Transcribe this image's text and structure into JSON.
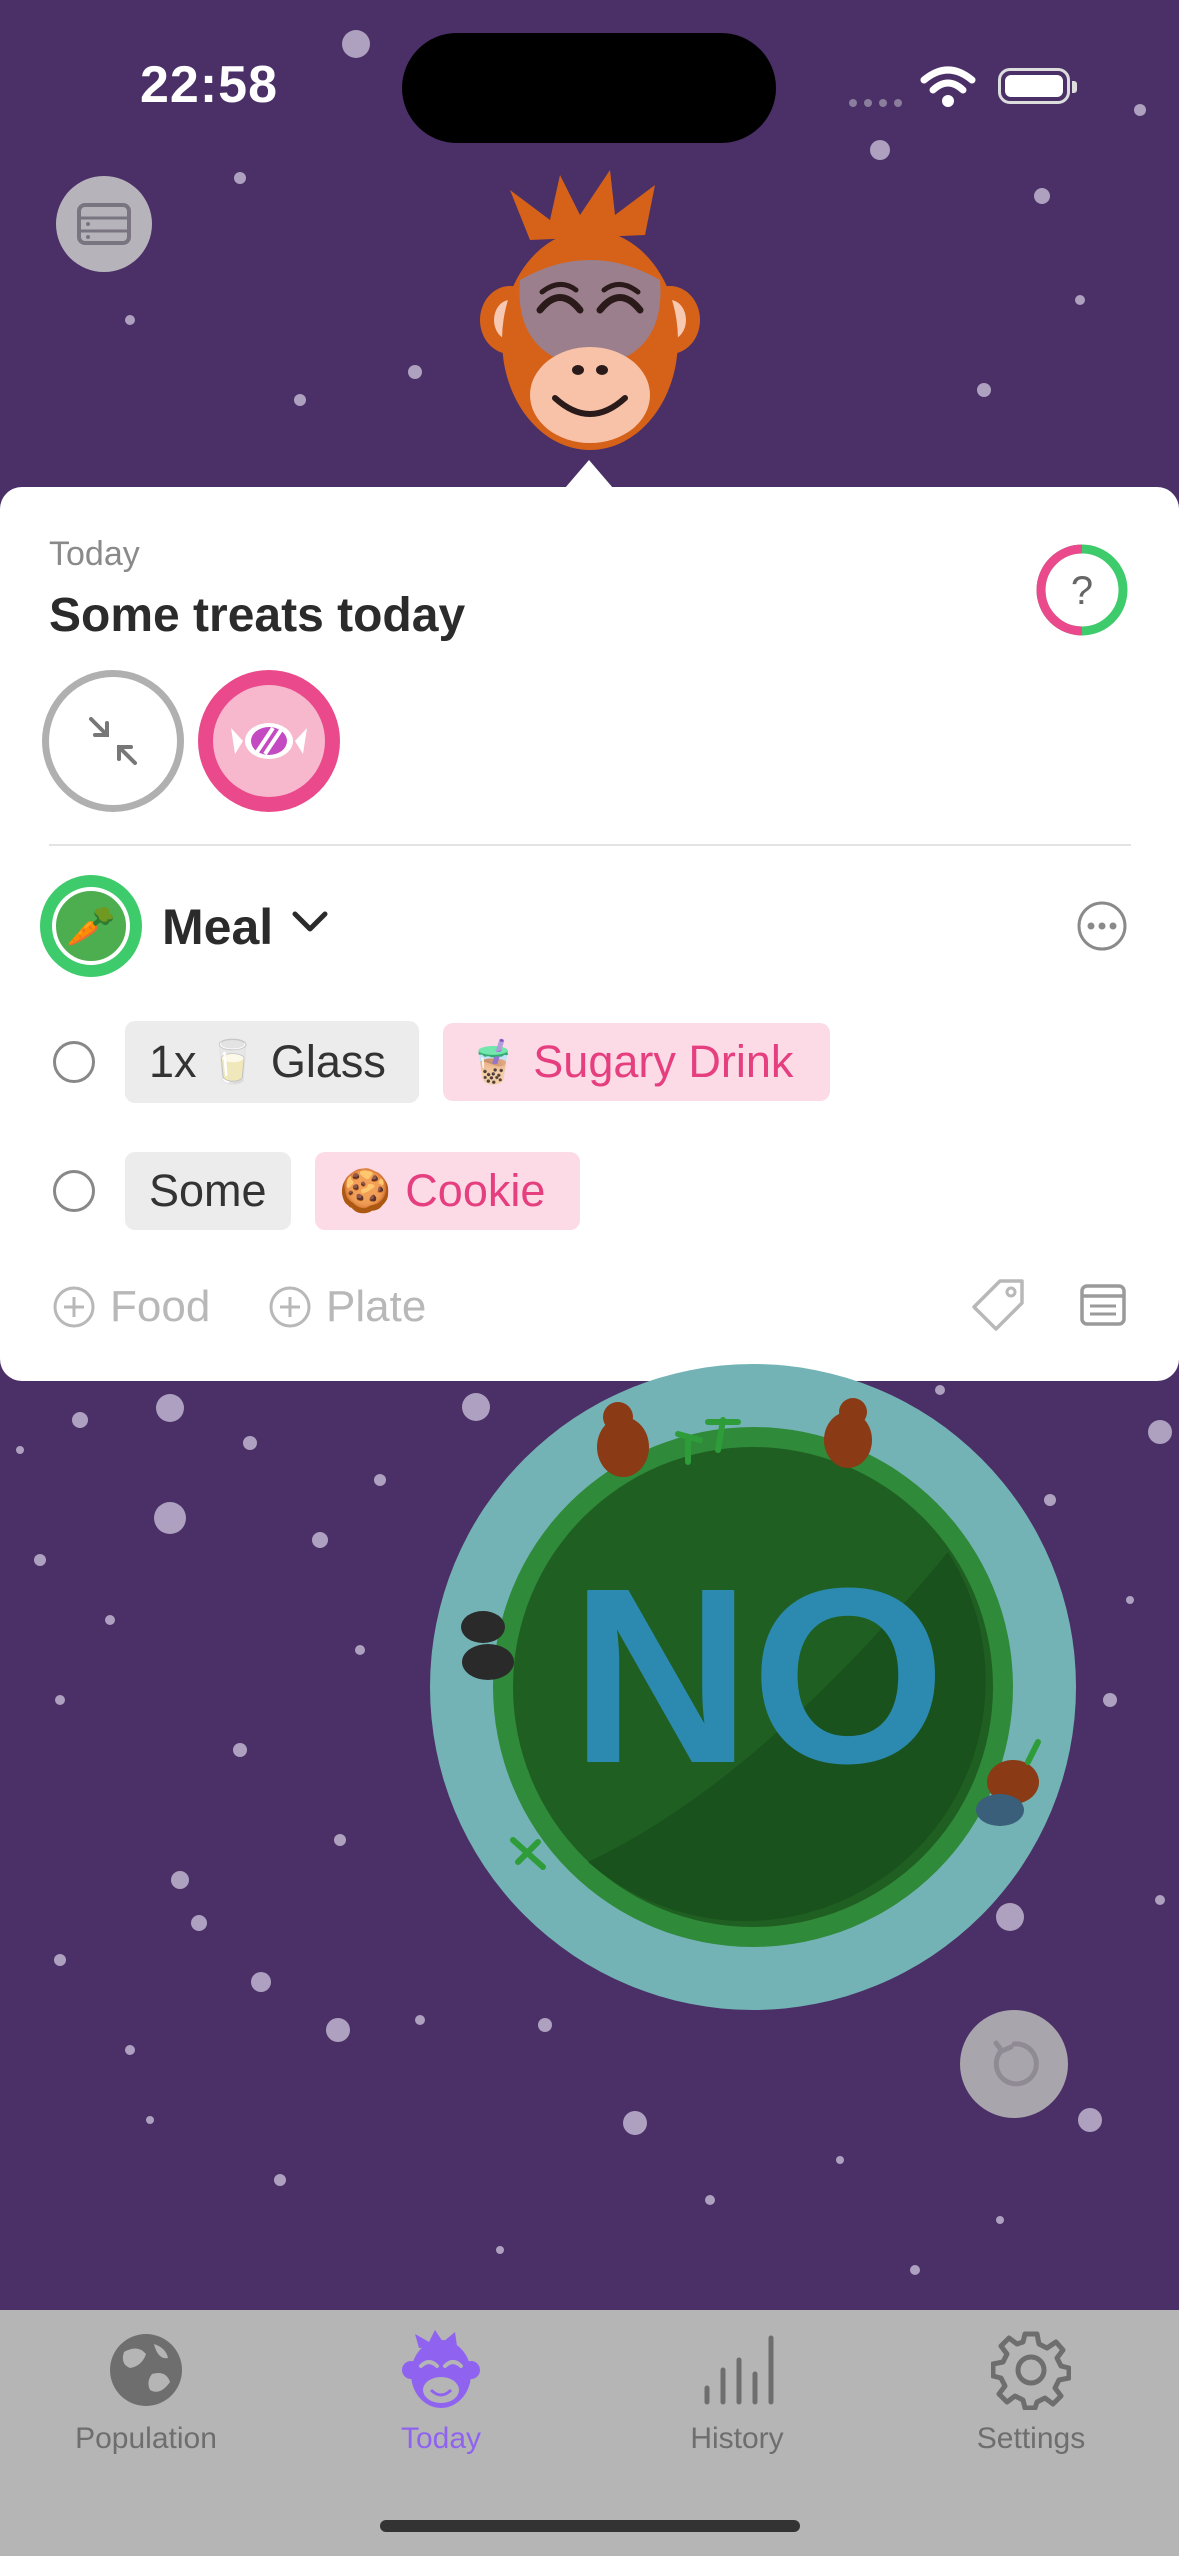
{
  "status_bar": {
    "time": "22:58"
  },
  "popover": {
    "date_label": "Today",
    "title": "Some treats today",
    "help_icon": "question-icon",
    "rings": [
      "collapse-icon",
      "candy-icon"
    ]
  },
  "meal": {
    "label": "Meal",
    "icon": "carrot-icon",
    "items": [
      {
        "portion": "1x",
        "portion_emoji": "🥛",
        "unit": "Glass",
        "food_emoji": "🧋",
        "food": "Sugary Drink"
      },
      {
        "portion": "Some",
        "portion_emoji": "",
        "unit": "",
        "food_emoji": "🍪",
        "food": "Cookie"
      }
    ]
  },
  "actions": {
    "add_food": "Food",
    "add_plate": "Plate"
  },
  "planet": {
    "text": "NO"
  },
  "tabs": [
    {
      "label": "Population",
      "icon": "globe-icon",
      "active": false
    },
    {
      "label": "Today",
      "icon": "monkey-icon",
      "active": true
    },
    {
      "label": "History",
      "icon": "chart-bars-icon",
      "active": false
    },
    {
      "label": "Settings",
      "icon": "gear-icon",
      "active": false
    }
  ],
  "colors": {
    "background": "#4a3067",
    "accent": "#8f63f0",
    "pink": "#ea4a8c",
    "green": "#3ecb6b",
    "planet_water": "#74b3b5",
    "planet_land": "#1f5f22"
  }
}
